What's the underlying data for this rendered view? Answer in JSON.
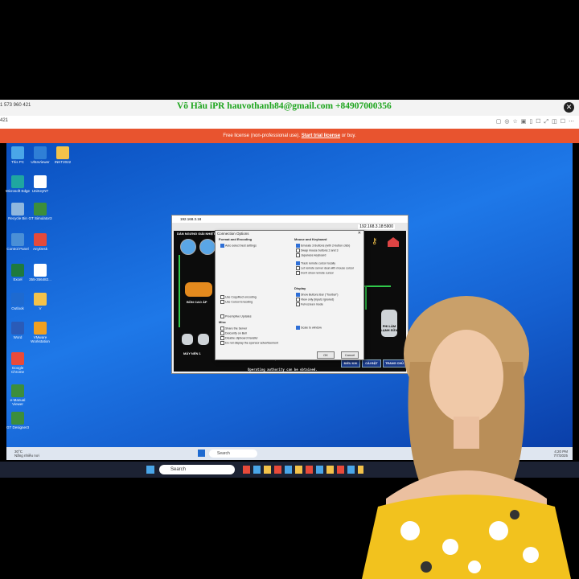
{
  "browser": {
    "left_text": "1 573 960 421",
    "title": "Võ Hầu iPR hauvothanh84@gmail.com +84907000356",
    "addr_left": "421"
  },
  "banner": {
    "text": "Free license (non-professional use).",
    "link": "Start trial license",
    "tail": "or buy."
  },
  "desktop_icons": [
    {
      "label": "This PC",
      "color": "#4aa6e8"
    },
    {
      "label": "UltraViewer",
      "color": "#2f7fd6"
    },
    {
      "label": "INKT2022",
      "color": "#f3c24a"
    },
    {
      "label": "Microsoft Edge",
      "color": "#1fa6a0"
    },
    {
      "label": "UniKeyNT",
      "color": "#ffffff"
    },
    {
      "label": "Recycle Bin",
      "color": "#8fb7de"
    },
    {
      "label": "GT Simulator3",
      "color": "#3c8e3c"
    },
    {
      "label": "Control Panel",
      "color": "#4a8fd6"
    },
    {
      "label": "AnyDesk",
      "color": "#e44a3a"
    },
    {
      "label": "Excel",
      "color": "#1e7a3e"
    },
    {
      "label": "355-356482...",
      "color": "#ffffff"
    },
    {
      "label": "Outlook",
      "color": "#1e6ad0"
    },
    {
      "label": "V",
      "color": "#f3c24a"
    },
    {
      "label": "Word",
      "color": "#2a5bb8"
    },
    {
      "label": "VMware Workstation",
      "color": "#f0a020"
    },
    {
      "label": "Google Chrome",
      "color": "#e84a3a"
    },
    {
      "label": "e-Manual Viewer",
      "color": "#3c8e3c"
    },
    {
      "label": "GT Designer3",
      "color": "#3c8e3c"
    }
  ],
  "remote_taskbar": {
    "search": "Search",
    "weather_line1": "30°C",
    "weather_line2": "Nắng nhiều nơi",
    "time": "4:20 PM",
    "date": "7/7/2025"
  },
  "local_taskbar": {
    "search": "Search"
  },
  "vnc": {
    "title": "192.168.3.18",
    "ip_display": "192.168.3.18:5900",
    "scada_title": "DÀN NGƯNG GIẢI NHIỆT",
    "labels": [
      "BỒN CAO ÁP",
      "MÁY NÉN 1",
      "BỒN HẠ ÁP",
      "BƠM 3"
    ],
    "tank_label": "PHI LÀM LẠNH SỮA",
    "footer": "Operating authority can be obtained.",
    "buttons": [
      "ĐIỀU KHI",
      "CÀI ĐẶT",
      "TRANG CHỦ"
    ]
  },
  "dialog": {
    "title": "Connection Options",
    "left_group": "Format and Encoding",
    "left_items": [
      "Auto select best settings",
      "Use CopyRect encoding",
      "Use Cursor Encoding",
      "Preemptive Updates"
    ],
    "misc_group": "Misc",
    "misc_items": [
      "Share the Server",
      "Deiconify on Bell",
      "Disable clipboard transfer",
      "Do not display the sponsor advertisement"
    ],
    "right_group": "Mouse and Keyboard",
    "right_items": [
      "Emulate 3 Buttons (with 2-button click)",
      "Swap mouse buttons 2 and 3",
      "Japanese keyboard",
      "Track remote cursor locally",
      "Let remote server deal with mouse cursor",
      "Don't show remote cursor"
    ],
    "display_group": "Display",
    "display_items": [
      "Show Buttons Bar (\"Toolbar\")",
      "View only (inputs ignored)",
      "Full-screen mode",
      "Scale to window"
    ],
    "ok": "OK",
    "cancel": "Cancel"
  }
}
